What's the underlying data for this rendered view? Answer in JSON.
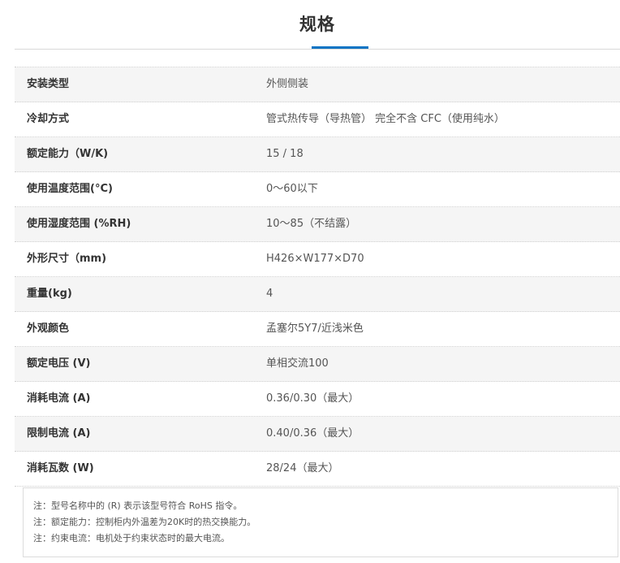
{
  "title": "规格",
  "specs": [
    {
      "label": "安装类型",
      "value": "外侧侧装"
    },
    {
      "label": "冷却方式",
      "value": "管式热传导（导热管） 完全不含 CFC（使用纯水）"
    },
    {
      "label": "额定能力（W/K)",
      "value": "15 / 18"
    },
    {
      "label": "使用温度范围(°C)",
      "value": "0～60以下"
    },
    {
      "label": "使用湿度范围 (%RH)",
      "value": "10～85（不结露）"
    },
    {
      "label": "外形尺寸（mm)",
      "value": "H426×W177×D70"
    },
    {
      "label": "重量(kg)",
      "value": "4"
    },
    {
      "label": "外观颜色",
      "value": "孟塞尔5Y7/近浅米色"
    },
    {
      "label": "额定电压 (V)",
      "value": "单相交流100"
    },
    {
      "label": "消耗电流 (A)",
      "value": "0.36/0.30（最大）"
    },
    {
      "label": "限制电流 (A)",
      "value": "0.40/0.36（最大）"
    },
    {
      "label": "消耗瓦数 (W)",
      "value": "28/24（最大）"
    }
  ],
  "notes": [
    "注：型号名称中的 (R) 表示该型号符合 RoHS 指令。",
    "注：额定能力：控制柜内外温差为20K时的热交换能力。",
    "注：约束电流：电机处于约束状态时的最大电流。"
  ]
}
